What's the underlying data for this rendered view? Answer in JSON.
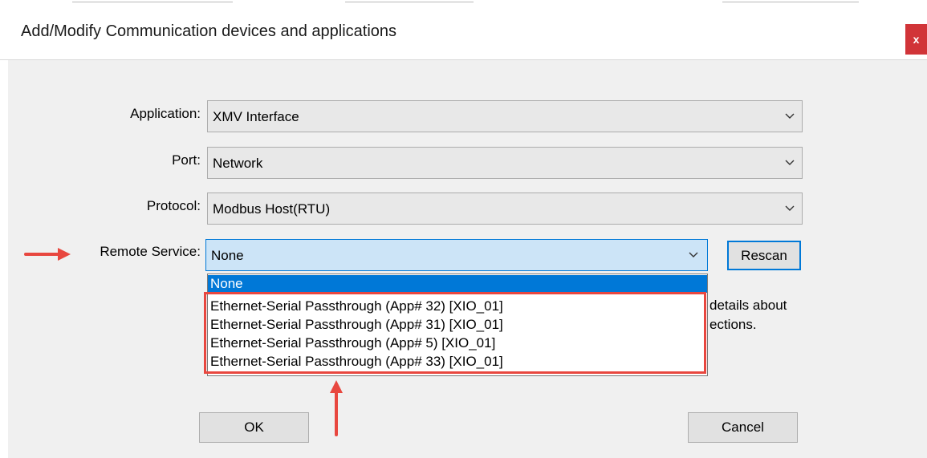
{
  "window": {
    "title": "Add/Modify Communication devices and applications",
    "close_label": "x"
  },
  "form": {
    "application": {
      "label": "Application:",
      "value": "XMV Interface"
    },
    "port": {
      "label": "Port:",
      "value": "Network"
    },
    "protocol": {
      "label": "Protocol:",
      "value": "Modbus Host(RTU)"
    },
    "remote_service": {
      "label": "Remote Service:",
      "value": "None",
      "options": [
        "None",
        "Ethernet-Serial Passthrough  (App# 32) [XIO_01]",
        "Ethernet-Serial Passthrough (App# 31) [XIO_01]",
        "Ethernet-Serial Passthrough (App# 5) [XIO_01]",
        "Ethernet-Serial Passthrough (App# 33) [XIO_01]"
      ]
    }
  },
  "buttons": {
    "rescan": "Rescan",
    "ok": "OK",
    "cancel": "Cancel"
  },
  "obscured_text": {
    "line1": "details about",
    "line2": "ections."
  },
  "annotations": {
    "arrow_color": "#e8473f",
    "highlight_color": "#e8473f"
  },
  "colors": {
    "accent": "#0078d7",
    "close": "#d13438"
  }
}
